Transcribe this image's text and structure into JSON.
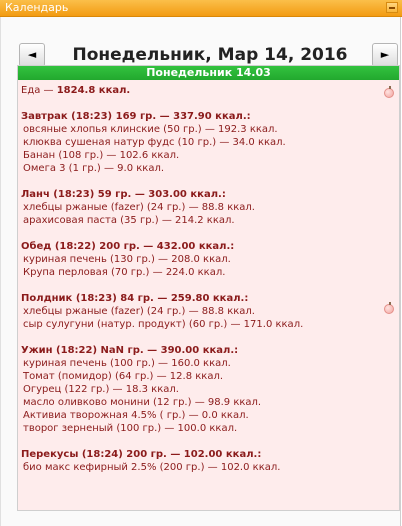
{
  "header": {
    "title": "Календарь"
  },
  "nav": {
    "prev_label": "◄",
    "next_label": "►",
    "date": "Понедельник, Мар 14, 2016"
  },
  "day": {
    "bar_title": "Понедельник 14.03",
    "total_label": "Еда — ",
    "total_value": "1824.8 ккал.",
    "meals": [
      {
        "title": "Завтрак (18:23) 169 гр. — 337.90 ккал.:",
        "items": [
          "овсяные хлопья клинские (50 гр.) — 192.3 ккал.",
          "клюква сушеная натур фудс (10 гр.) — 34.0 ккал.",
          "Банан (108 гр.) — 102.6 ккал.",
          "Омега 3 (1 гр.) — 9.0 ккал."
        ]
      },
      {
        "title": "Ланч (18:23) 59 гр. — 303.00 ккал.:",
        "items": [
          "хлебцы ржаные (fazer) (24 гр.) — 88.8 ккал.",
          "арахисовая паста (35 гр.) — 214.2 ккал."
        ]
      },
      {
        "title": "Обед (18:22) 200 гр. — 432.00 ккал.:",
        "items": [
          "куриная печень (130 гр.) — 208.0 ккал.",
          "Крупа перловая (70 гр.) — 224.0 ккал."
        ]
      },
      {
        "title": "Полдник (18:23) 84 гр. — 259.80 ккал.:",
        "items": [
          "хлебцы ржаные (fazer) (24 гр.) — 88.8 ккал.",
          "сыр сулугуни (натур. продукт) (60 гр.) — 171.0 ккал."
        ]
      },
      {
        "title": "Ужин (18:22) NaN гр. — 390.00 ккал.:",
        "items": [
          "куриная печень (100 гр.) — 160.0 ккал.",
          "Томат (помидор) (64 гр.) — 12.8 ккал.",
          "Огурец (122 гр.) — 18.3 ккал.",
          "масло оливково монини (12 гр.) — 98.9 ккал.",
          "Активиа творожная 4.5% ( гр.) — 0.0 ккал.",
          "творог зерненый (100 гр.) — 100.0 ккал."
        ]
      },
      {
        "title": "Перекусы (18:24) 200 гр. — 102.00 ккал.:",
        "items": [
          "био макс кефирный 2.5% (200 гр.) — 102.0 ккал."
        ]
      }
    ]
  },
  "icons": {
    "apple": "apple-icon",
    "collapse": "collapse-icon"
  }
}
